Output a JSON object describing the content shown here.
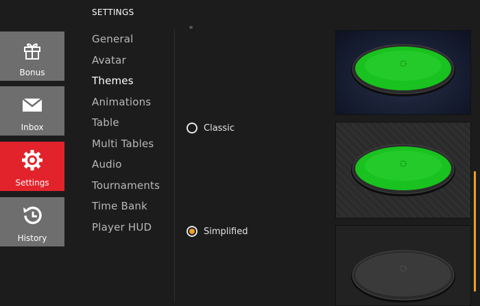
{
  "header": {
    "title": "SETTINGS"
  },
  "rail": {
    "items": [
      {
        "label": "Bonus",
        "icon": "gift-icon"
      },
      {
        "label": "Inbox",
        "icon": "envelope-icon"
      },
      {
        "label": "Settings",
        "icon": "gear-icon",
        "active": true
      },
      {
        "label": "History",
        "icon": "history-icon"
      }
    ]
  },
  "submenu": {
    "items": [
      "General",
      "Avatar",
      "Themes",
      "Animations",
      "Table",
      "Multi Tables",
      "Audio",
      "Tournaments",
      "Time Bank",
      "Player HUD"
    ],
    "active": "Themes"
  },
  "themes": {
    "options": [
      {
        "label": "Classic",
        "selected": false
      },
      {
        "label": "Simplified",
        "selected": true
      }
    ]
  },
  "colors": {
    "accent": "#f0a021",
    "active_nav": "#e3232b",
    "felt_green": "#19c21f",
    "rail_inactive": "#6e6e6e"
  }
}
